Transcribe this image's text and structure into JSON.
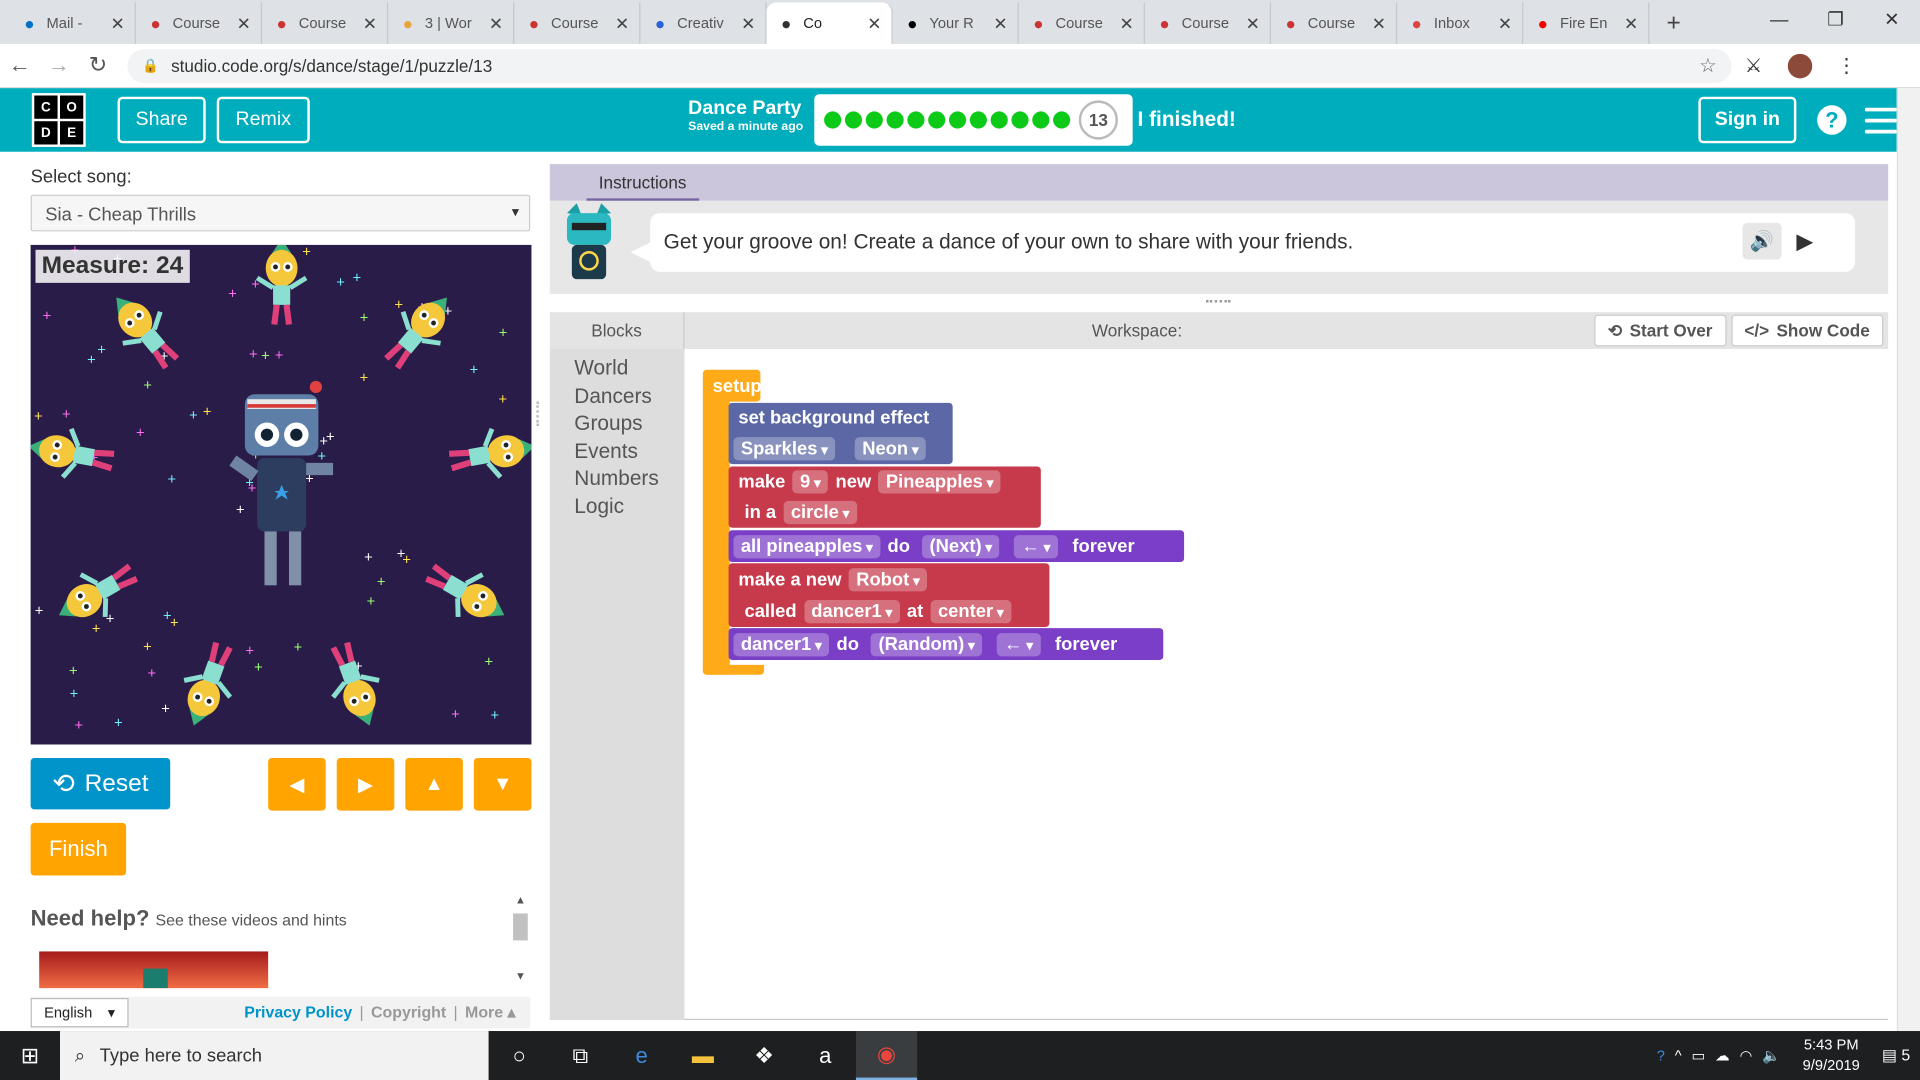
{
  "browser": {
    "tabs": [
      {
        "label": "Mail - ",
        "icon": "outlook-icon",
        "color": "#0072c6"
      },
      {
        "label": "Course",
        "icon": "power-icon",
        "color": "#c33"
      },
      {
        "label": "Course",
        "icon": "power-icon",
        "color": "#c33"
      },
      {
        "label": "3 | Wor",
        "icon": "globe-icon",
        "color": "#e8a33c"
      },
      {
        "label": "Course",
        "icon": "power-icon",
        "color": "#c33"
      },
      {
        "label": "Creativ",
        "icon": "drive-icon",
        "color": "#2a62d8"
      },
      {
        "label": "Co",
        "icon": "codeorg-icon",
        "color": "#333"
      },
      {
        "label": "Your R",
        "icon": "github-icon",
        "color": "#000"
      },
      {
        "label": "Course",
        "icon": "power-icon",
        "color": "#c33"
      },
      {
        "label": "Course",
        "icon": "power-icon",
        "color": "#c33"
      },
      {
        "label": "Course",
        "icon": "power-icon",
        "color": "#c33"
      },
      {
        "label": "Inbox",
        "icon": "gmail-icon",
        "color": "#d44"
      },
      {
        "label": "Fire En",
        "icon": "youtube-icon",
        "color": "#e00"
      }
    ],
    "active_tab": 6,
    "url": "studio.code.org/s/dance/stage/1/puzzle/13"
  },
  "header": {
    "logo": [
      "C",
      "O",
      "D",
      "E"
    ],
    "share": "Share",
    "remix": "Remix",
    "project_name": "Dance Party",
    "saved": "Saved a minute ago",
    "progress_done": 12,
    "puzzle_number": "13",
    "finished": "I finished!",
    "sign_in": "Sign in",
    "help": "?"
  },
  "left": {
    "select_song_label": "Select song:",
    "song": "Sia - Cheap Thrills",
    "measure": "Measure: 24",
    "reset": "Reset",
    "finish": "Finish",
    "need_help": "Need help?",
    "need_help_sub": "See these videos and hints",
    "language": "English",
    "privacy": "Privacy Policy",
    "copyright": "Copyright",
    "more": "More ▴"
  },
  "instructions": {
    "tab": "Instructions",
    "text": "Get your groove on! Create a dance of your own to share with your friends."
  },
  "workspace": {
    "blocks_label": "Blocks",
    "workspace_label": "Workspace:",
    "start_over": "Start Over",
    "show_code": "Show Code",
    "categories": [
      "World",
      "Dancers",
      "Groups",
      "Events",
      "Numbers",
      "Logic"
    ],
    "setup": "setup",
    "bg_effect": "set background effect",
    "bg_effect_value": "Sparkles",
    "bg_palette": "Neon",
    "make": "make",
    "make_count": "9",
    "new": "new",
    "make_type": "Pineapples",
    "in_a": "in a",
    "layout": "circle",
    "group": "all pineapples",
    "do": "do",
    "group_move": "(Next)",
    "direction": "←",
    "forever": "forever",
    "make_new": "make a new",
    "robot": "Robot",
    "called": "called",
    "dancer_name": "dancer1",
    "at": "at",
    "position": "center",
    "dancer_move": "(Random)"
  },
  "taskbar": {
    "search": "Type here to search",
    "time": "5:43 PM",
    "date": "9/9/2019",
    "notifications": "5"
  },
  "colors": {
    "accent": "#00adbc",
    "orange": "#ffa400",
    "blue": "#0094ca",
    "block_setup": "#ffab19",
    "block_world": "#5c68a6",
    "block_dancer": "#c63a4b",
    "block_group": "#7b3ec6"
  }
}
